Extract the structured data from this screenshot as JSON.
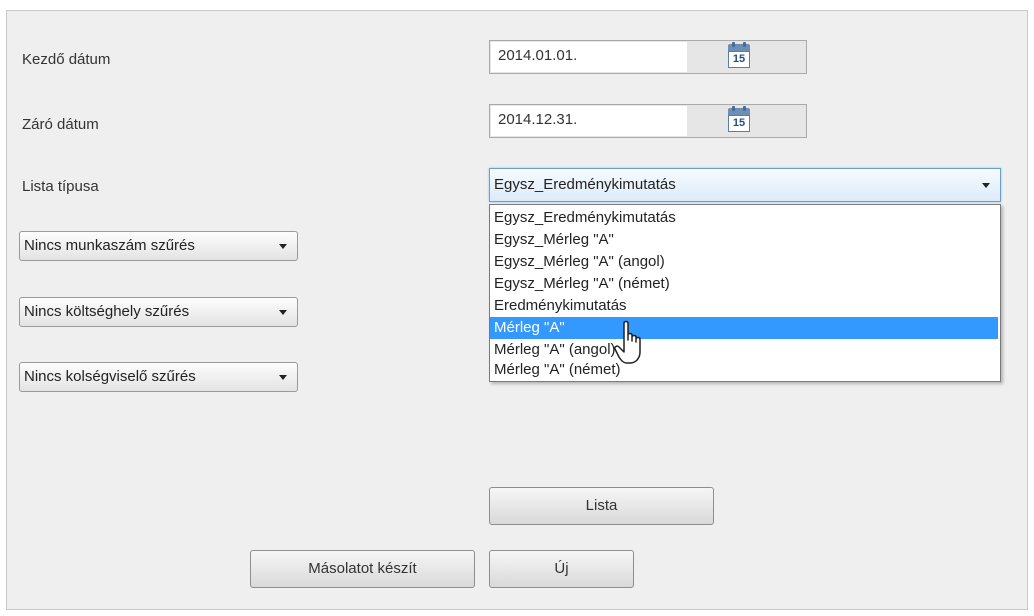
{
  "form": {
    "start_date": {
      "label": "Kezdő dátum",
      "value": "2014.01.01.",
      "calendar_day": "15"
    },
    "end_date": {
      "label": "Záró dátum",
      "value": "2014.12.31.",
      "calendar_day": "15"
    },
    "list_type": {
      "label": "Lista típusa",
      "selected": "Egysz_Eredménykimutatás",
      "options": [
        "Egysz_Eredménykimutatás",
        "Egysz_Mérleg \"A\"",
        "Egysz_Mérleg \"A\" (angol)",
        "Egysz_Mérleg \"A\" (német)",
        "Eredménykimutatás",
        "Mérleg \"A\"",
        "Mérleg \"A\" (angol)",
        "Mérleg \"A\" (német)"
      ],
      "highlighted_index": 5
    },
    "filters": {
      "job_number": "Nincs munkaszám szűrés",
      "cost_center": "Nincs költséghely szűrés",
      "cost_bearer": "Nincs kolségviselő szűrés"
    },
    "buttons": {
      "list": "Lista",
      "copy": "Másolatot készít",
      "new": "Új"
    }
  },
  "colors": {
    "highlight": "#3399ff",
    "panel": "#efefef"
  },
  "icons": [
    "calendar-icon",
    "chevron-down-icon",
    "hand-pointer-icon"
  ]
}
